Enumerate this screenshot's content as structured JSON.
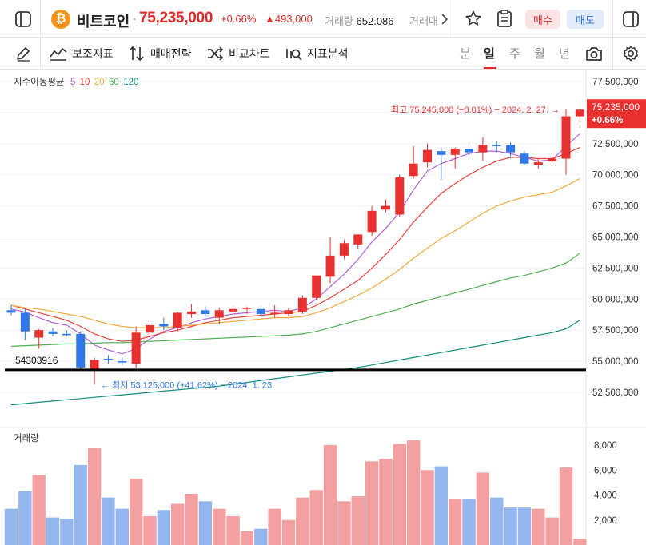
{
  "header": {
    "coin_symbol": "₿",
    "coin_name": "비트코인",
    "separator": "·",
    "price": "75,235,000",
    "change_pct": "+0.66%",
    "change_abs": "▲493,000",
    "volume_label": "거래량",
    "volume_value": "652.086",
    "truncated_next": "거래대",
    "buy_label": "매수",
    "sell_label": "매도",
    "icons": [
      "sidebar-toggle-icon",
      "chevron-right-icon",
      "star-icon",
      "clipboard-icon",
      "panel-toggle-icon"
    ]
  },
  "toolbar": {
    "draw_icon": "pencil-icon",
    "indicator_label": "보조지표",
    "strategy_label": "매매전략",
    "compare_label": "비교차트",
    "analysis_label": "지표분석",
    "periods": [
      "분",
      "일",
      "주",
      "월",
      "년"
    ],
    "active_period": "일",
    "icons": [
      "camera-icon",
      "settings-gear-icon"
    ]
  },
  "chart_data": {
    "type": "candlestick",
    "ma_legend": {
      "label": "지수이동평균",
      "items": [
        {
          "name": "5",
          "color": "#b561d8"
        },
        {
          "name": "10",
          "color": "#e8453c"
        },
        {
          "name": "20",
          "color": "#f2a93b"
        },
        {
          "name": "60",
          "color": "#4caf50"
        },
        {
          "name": "120",
          "color": "#138f7f"
        }
      ]
    },
    "y_axis": {
      "min": 51500000,
      "max": 77500000,
      "ticks": [
        "77,500,000",
        "75,000,000",
        "72,500,000",
        "70,000,000",
        "67,500,000",
        "65,000,000",
        "62,500,000",
        "60,000,000",
        "57,500,000",
        "55,000,000",
        "52,500,000"
      ],
      "tick_values": [
        77500000,
        75000000,
        72500000,
        70000000,
        67500000,
        65000000,
        62500000,
        60000000,
        57500000,
        55000000,
        52500000
      ]
    },
    "current_price": {
      "value": 75235000,
      "label": "75,235,000",
      "pct": "+0.66%",
      "color": "#e8302e"
    },
    "high_annotation": {
      "text": "최고 75,245,000 (−0.01%) − 2024. 2. 27.",
      "arrow": "→",
      "value": 75245000
    },
    "low_annotation": {
      "text": "최저 53,125,000 (+41.62%) − 2024. 1. 23.",
      "arrow": "←",
      "value": 53125000
    },
    "horizontal_line": {
      "value": 54303916,
      "label": "54303916"
    },
    "candles": [
      {
        "o": 59100000,
        "h": 59500000,
        "l": 58700000,
        "c": 58900000,
        "v": 2900
      },
      {
        "o": 58900000,
        "h": 59200000,
        "l": 56700000,
        "c": 57400000,
        "v": 4300
      },
      {
        "o": 56900000,
        "h": 57600000,
        "l": 56000000,
        "c": 57500000,
        "v": 5600
      },
      {
        "o": 57400000,
        "h": 57700000,
        "l": 57000000,
        "c": 57200000,
        "v": 2200
      },
      {
        "o": 57200000,
        "h": 57500000,
        "l": 57000000,
        "c": 57100000,
        "v": 2100
      },
      {
        "o": 57200000,
        "h": 57400000,
        "l": 54400000,
        "c": 54500000,
        "v": 6400
      },
      {
        "o": 54400000,
        "h": 55300000,
        "l": 53125000,
        "c": 55100000,
        "v": 7800
      },
      {
        "o": 55200000,
        "h": 55500000,
        "l": 54800000,
        "c": 55100000,
        "v": 3800
      },
      {
        "o": 55000000,
        "h": 55300000,
        "l": 54700000,
        "c": 54900000,
        "v": 2900
      },
      {
        "o": 54800000,
        "h": 57800000,
        "l": 54500000,
        "c": 57300000,
        "v": 5300
      },
      {
        "o": 57300000,
        "h": 58100000,
        "l": 57000000,
        "c": 57900000,
        "v": 2300
      },
      {
        "o": 58000000,
        "h": 58500000,
        "l": 57500000,
        "c": 57800000,
        "v": 2800
      },
      {
        "o": 57700000,
        "h": 59000000,
        "l": 57400000,
        "c": 58900000,
        "v": 3300
      },
      {
        "o": 58800000,
        "h": 59600000,
        "l": 58500000,
        "c": 59000000,
        "v": 4100
      },
      {
        "o": 59100000,
        "h": 59400000,
        "l": 58600000,
        "c": 58800000,
        "v": 3500
      },
      {
        "o": 58500000,
        "h": 59300000,
        "l": 58000000,
        "c": 59100000,
        "v": 2900
      },
      {
        "o": 59000000,
        "h": 59400000,
        "l": 58700000,
        "c": 59200000,
        "v": 2300
      },
      {
        "o": 59200000,
        "h": 59400000,
        "l": 58800000,
        "c": 59300000,
        "v": 1100
      },
      {
        "o": 59200000,
        "h": 59400000,
        "l": 58700000,
        "c": 58800000,
        "v": 1300
      },
      {
        "o": 58800000,
        "h": 59500000,
        "l": 58500000,
        "c": 58900000,
        "v": 2900
      },
      {
        "o": 58800000,
        "h": 59300000,
        "l": 58600000,
        "c": 59100000,
        "v": 2000
      },
      {
        "o": 59000000,
        "h": 60300000,
        "l": 58800000,
        "c": 60100000,
        "v": 3800
      },
      {
        "o": 60100000,
        "h": 61900000,
        "l": 59900000,
        "c": 61900000,
        "v": 4400
      },
      {
        "o": 61800000,
        "h": 65000000,
        "l": 61300000,
        "c": 63500000,
        "v": 8000
      },
      {
        "o": 63500000,
        "h": 64800000,
        "l": 63200000,
        "c": 64500000,
        "v": 3500
      },
      {
        "o": 64400000,
        "h": 65200000,
        "l": 64000000,
        "c": 65200000,
        "v": 3900
      },
      {
        "o": 65400000,
        "h": 67500000,
        "l": 65100000,
        "c": 67100000,
        "v": 6700
      },
      {
        "o": 67200000,
        "h": 68000000,
        "l": 67000000,
        "c": 67500000,
        "v": 6900
      },
      {
        "o": 66800000,
        "h": 70000000,
        "l": 66600000,
        "c": 69800000,
        "v": 8100
      },
      {
        "o": 69900000,
        "h": 72300000,
        "l": 69700000,
        "c": 70900000,
        "v": 8400
      },
      {
        "o": 71000000,
        "h": 72500000,
        "l": 70600000,
        "c": 72000000,
        "v": 6000
      },
      {
        "o": 71900000,
        "h": 72200000,
        "l": 69600000,
        "c": 71600000,
        "v": 6300
      },
      {
        "o": 71600000,
        "h": 72200000,
        "l": 70500000,
        "c": 72100000,
        "v": 3700
      },
      {
        "o": 72100000,
        "h": 72400000,
        "l": 71600000,
        "c": 71800000,
        "v": 3700
      },
      {
        "o": 71800000,
        "h": 73000000,
        "l": 71100000,
        "c": 72400000,
        "v": 5800
      },
      {
        "o": 72400000,
        "h": 72700000,
        "l": 71800000,
        "c": 72300000,
        "v": 3800
      },
      {
        "o": 72400000,
        "h": 72600000,
        "l": 71300000,
        "c": 71800000,
        "v": 3000
      },
      {
        "o": 71700000,
        "h": 71900000,
        "l": 70800000,
        "c": 70900000,
        "v": 3000
      },
      {
        "o": 70800000,
        "h": 71300000,
        "l": 70500000,
        "c": 71000000,
        "v": 2900
      },
      {
        "o": 71100000,
        "h": 71500000,
        "l": 70900000,
        "c": 71300000,
        "v": 2200
      },
      {
        "o": 71300000,
        "h": 75300000,
        "l": 70000000,
        "c": 74700000,
        "v": 6200
      },
      {
        "o": 74700000,
        "h": 75300000,
        "l": 74200000,
        "c": 75235000,
        "v": 500
      }
    ],
    "ma_series": {
      "5": [
        59200000,
        58950000,
        58500000,
        58100000,
        57900000,
        57200000,
        56300000,
        55900000,
        55600000,
        56000000,
        56800000,
        57400000,
        57700000,
        58100000,
        58400000,
        58600000,
        58800000,
        58900000,
        59000000,
        59100000,
        59000000,
        59300000,
        60000000,
        61000000,
        62000000,
        63200000,
        64600000,
        65700000,
        67000000,
        68800000,
        70300000,
        70900000,
        71300000,
        71700000,
        71900000,
        71900000,
        71700000,
        71400000,
        71100000,
        71200000,
        72300000,
        73300000
      ],
      "10": [
        59500000,
        59200000,
        58900000,
        58600000,
        58300000,
        57800000,
        57200000,
        56800000,
        56600000,
        56700000,
        57000000,
        57300000,
        57500000,
        57800000,
        58100000,
        58300000,
        58500000,
        58600000,
        58700000,
        58800000,
        58900000,
        59000000,
        59500000,
        60100000,
        60800000,
        61500000,
        62500000,
        63600000,
        64800000,
        66200000,
        67400000,
        68500000,
        69300000,
        70000000,
        70600000,
        71100000,
        71400000,
        71400000,
        71300000,
        71300000,
        71700000,
        72200000
      ],
      "20": [
        59500000,
        59300000,
        59200000,
        59000000,
        58800000,
        58600000,
        58300000,
        58000000,
        57800000,
        57700000,
        57700000,
        57700000,
        57800000,
        57900000,
        58000000,
        58100000,
        58200000,
        58300000,
        58400000,
        58500000,
        58500000,
        58600000,
        58900000,
        59300000,
        59800000,
        60300000,
        60900000,
        61600000,
        62400000,
        63300000,
        64100000,
        64900000,
        65500000,
        66200000,
        66900000,
        67500000,
        67900000,
        68200000,
        68400000,
        68600000,
        69100000,
        69700000
      ],
      "60": [
        56200000,
        56250000,
        56300000,
        56350000,
        56400000,
        56400000,
        56450000,
        56500000,
        56500000,
        56550000,
        56600000,
        56650000,
        56700000,
        56750000,
        56800000,
        56850000,
        56900000,
        56950000,
        57000000,
        57050000,
        57100000,
        57200000,
        57400000,
        57700000,
        58000000,
        58300000,
        58600000,
        58900000,
        59200000,
        59600000,
        59900000,
        60200000,
        60500000,
        60800000,
        61100000,
        61400000,
        61700000,
        61900000,
        62200000,
        62500000,
        62900000,
        63700000
      ],
      "120": [
        51500000,
        51600000,
        51700000,
        51800000,
        51900000,
        52000000,
        52100000,
        52200000,
        52300000,
        52400000,
        52500000,
        52600000,
        52700000,
        52800000,
        52900000,
        53000000,
        53150000,
        53300000,
        53450000,
        53600000,
        53750000,
        53900000,
        54050000,
        54200000,
        54350000,
        54500000,
        54700000,
        54900000,
        55100000,
        55300000,
        55500000,
        55700000,
        55900000,
        56100000,
        56300000,
        56500000,
        56700000,
        56900000,
        57100000,
        57300000,
        57600000,
        58300000
      ]
    },
    "volume": {
      "label": "거래량",
      "ticks": [
        "8,000",
        "6,000",
        "4,000",
        "2,000"
      ],
      "tick_values": [
        8000,
        6000,
        4000,
        2000
      ],
      "max": 8800
    },
    "colors": {
      "up": "#e8302e",
      "down": "#2f78e6",
      "vol_up": "#f4a0a0",
      "vol_down": "#93b6ef",
      "grid": "#f1f1f1"
    }
  }
}
